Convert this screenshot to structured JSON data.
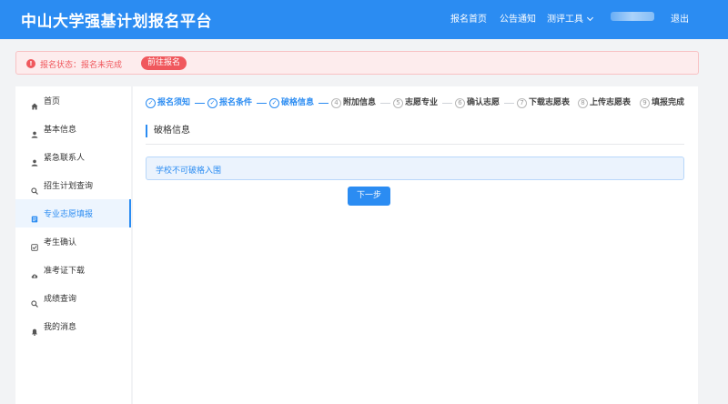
{
  "header": {
    "brand": "中山大学强基计划报名平台",
    "nav": {
      "home": "报名首页",
      "notice": "公告通知",
      "tools": "测评工具",
      "logout": "退出"
    }
  },
  "alert": {
    "text": "报名状态：报名未完成",
    "action": "前往报名"
  },
  "sidebar": {
    "items": [
      {
        "label": "首页",
        "icon": "home-icon"
      },
      {
        "label": "基本信息",
        "icon": "user-icon"
      },
      {
        "label": "紧急联系人",
        "icon": "user-icon"
      },
      {
        "label": "招生计划查询",
        "icon": "search-icon"
      },
      {
        "label": "专业志愿填报",
        "icon": "form-icon",
        "active": true
      },
      {
        "label": "考生确认",
        "icon": "check-icon"
      },
      {
        "label": "准考证下载",
        "icon": "cloud-download-icon"
      },
      {
        "label": "成绩查询",
        "icon": "search-icon"
      },
      {
        "label": "我的消息",
        "icon": "bell-icon"
      }
    ]
  },
  "steps": [
    {
      "num": "1",
      "label": "报名须知",
      "done": true
    },
    {
      "num": "2",
      "label": "报名条件",
      "done": true
    },
    {
      "num": "3",
      "label": "破格信息",
      "done": true
    },
    {
      "num": "4",
      "label": "附加信息",
      "done": false
    },
    {
      "num": "5",
      "label": "志愿专业",
      "done": false
    },
    {
      "num": "6",
      "label": "确认志愿",
      "done": false
    },
    {
      "num": "7",
      "label": "下载志愿表",
      "done": false
    },
    {
      "num": "8",
      "label": "上传志愿表",
      "done": false
    },
    {
      "num": "9",
      "label": "填报完成",
      "done": false
    }
  ],
  "main": {
    "section_title": "破格信息",
    "info": "学校不可破格入围",
    "next_label": "下一步"
  },
  "colors": {
    "primary": "#2b8cf2",
    "danger": "#f0585d",
    "info_bg": "#ebf3fd"
  }
}
